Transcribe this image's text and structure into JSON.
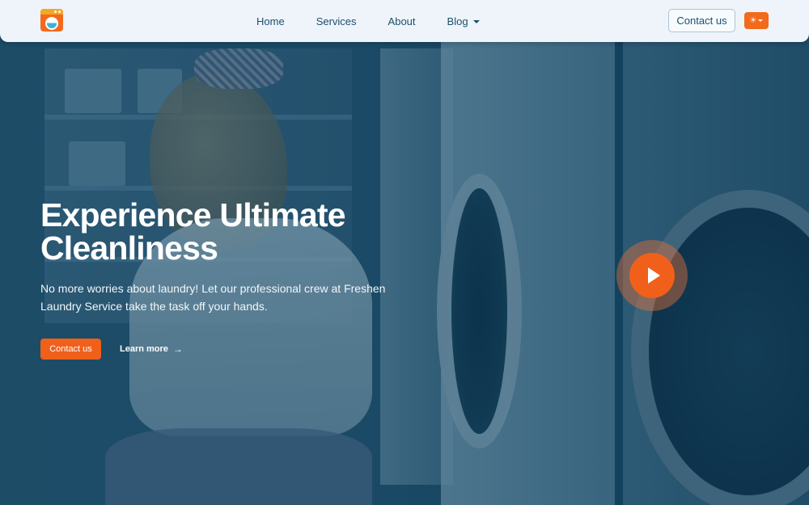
{
  "nav": {
    "links": [
      {
        "label": "Home"
      },
      {
        "label": "Services"
      },
      {
        "label": "About"
      },
      {
        "label": "Blog",
        "has_dropdown": true
      }
    ],
    "contact_label": "Contact us",
    "theme_icon": "sun-icon"
  },
  "hero": {
    "title_line1": "Experience Ultimate",
    "title_line2": "Cleanliness",
    "subtitle": "No more worries about laundry! Let our professional crew at Freshen Laundry Service take the task off your hands.",
    "contact_button": "Contact us",
    "learn_more": "Learn more",
    "learn_more_icon": "arrow-right-icon",
    "play_icon": "play-icon"
  },
  "colors": {
    "accent": "#f0601a",
    "nav_bg": "#eef4fa",
    "nav_text": "#1d4e6b",
    "overlay": "#0c3c5a"
  }
}
